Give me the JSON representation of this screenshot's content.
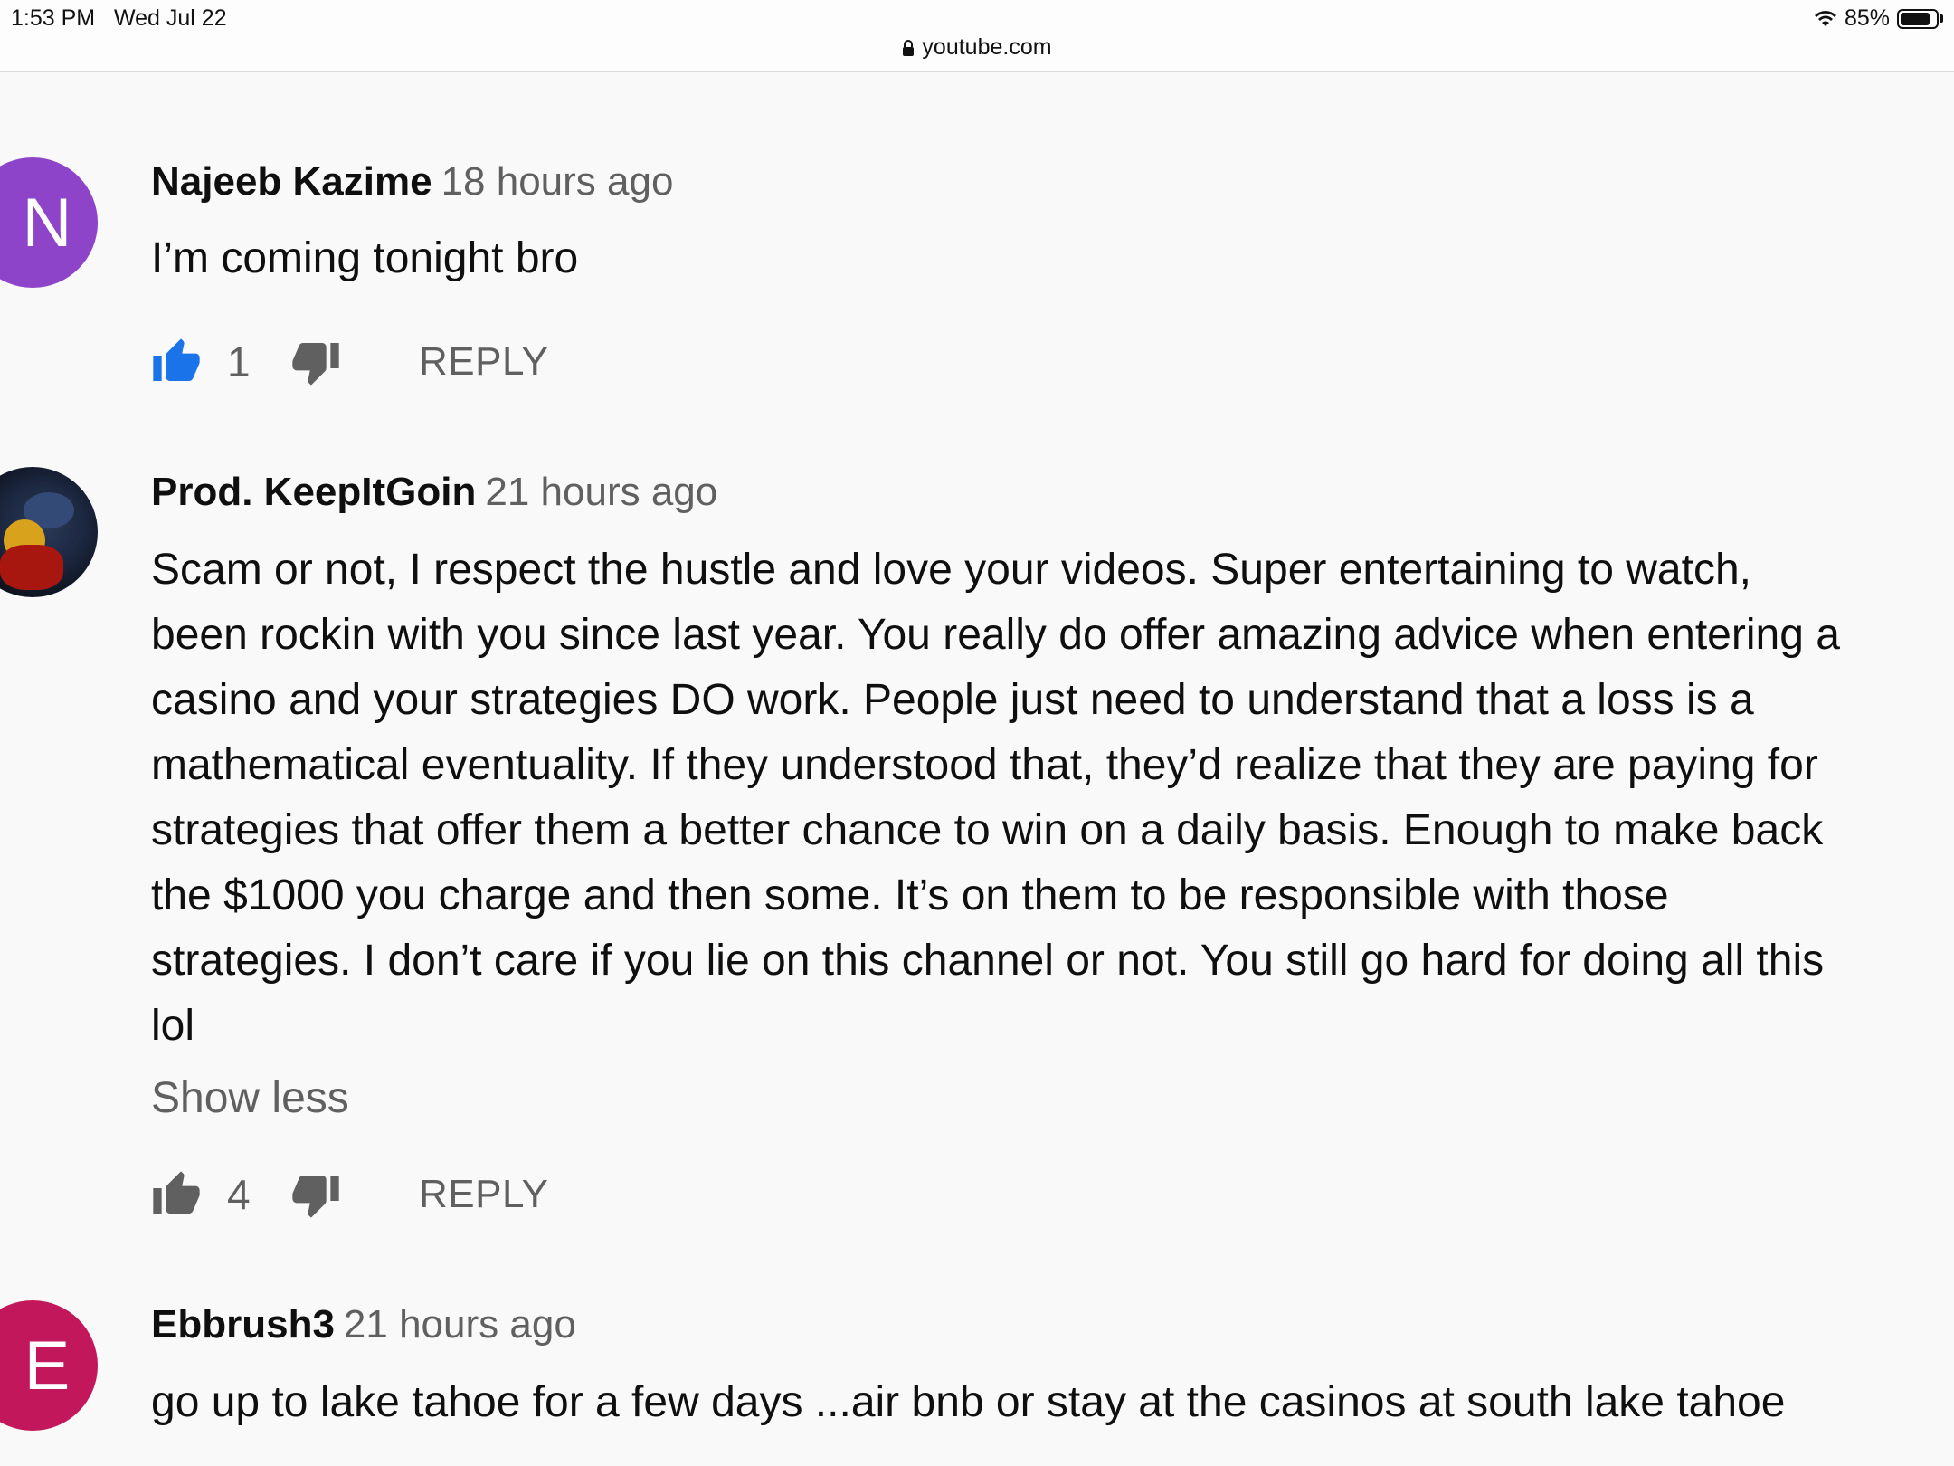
{
  "status_bar": {
    "time": "1:53 PM",
    "date": "Wed Jul 22",
    "battery": "85%",
    "battery_level": 0.85
  },
  "browser": {
    "url": "youtube.com",
    "lock_icon": "lock-icon"
  },
  "colors": {
    "like_active": "#1a73e8",
    "icon_gray": "#606060",
    "avatar_n": "#8e44c9",
    "avatar_e": "#c2185b"
  },
  "comments": [
    {
      "avatar_letter": "N",
      "author": "Najeeb Kazime",
      "time": "18 hours ago",
      "lines": [
        "I’m coming tonight bro"
      ],
      "likes": "1",
      "reply": "REPLY",
      "liked": true
    },
    {
      "avatar_letter": "",
      "author": "Prod. KeepItGoin",
      "time": "21 hours ago",
      "lines": [
        "Scam or not, I respect the hustle and love your videos. Super entertaining to watch,",
        "been rockin with you since last year. You really do offer amazing advice when entering a",
        "casino and your strategies DO work. People just need to understand that a loss is a",
        "mathematical eventuality. If they understood that, they’d realize that they are paying for",
        "strategies that offer them a better chance to win on a daily basis. Enough to make back",
        "the $1000 you charge and then some. It’s on them to be responsible with those",
        "strategies. I don’t care if you lie on this channel or not. You still go hard for doing all this",
        "lol"
      ],
      "show_less": "Show less",
      "likes": "4",
      "reply": "REPLY",
      "liked": false
    },
    {
      "avatar_letter": "E",
      "author": "Ebbrush3",
      "time": "21 hours ago",
      "lines": [
        "go up to lake tahoe for a few days ...air bnb or stay at the casinos at south lake tahoe"
      ]
    }
  ]
}
